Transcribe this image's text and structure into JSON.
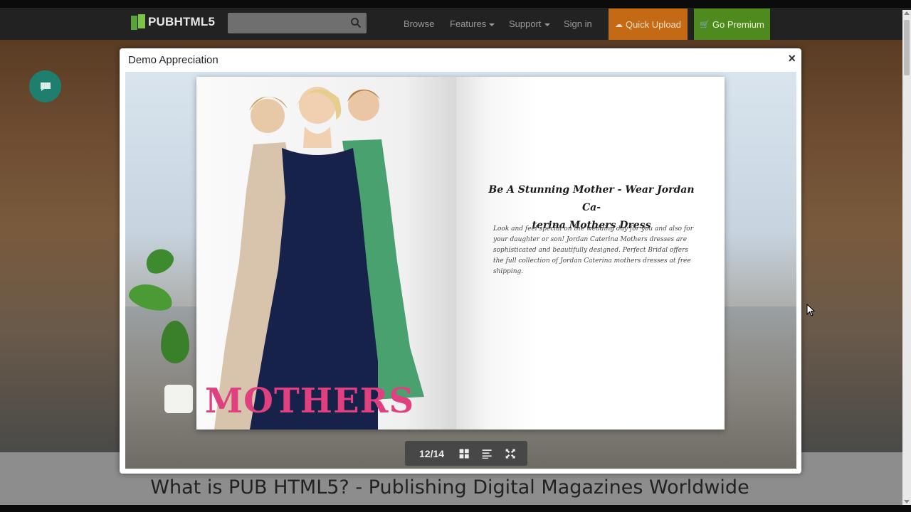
{
  "header": {
    "logo_text": "PUBHTML5",
    "search_placeholder": "",
    "nav": {
      "browse": "Browse",
      "features": "Features",
      "support": "Support",
      "signin": "Sign in"
    },
    "quick_upload": "Quick Upload",
    "go_premium": "Go Premium"
  },
  "modal": {
    "title": "Demo Appreciation",
    "close": "×",
    "left_page_word": "MOTHERS",
    "right_page_headline_1": "Be A Stunning Mother - Wear Jordan Ca-",
    "right_page_headline_2": "terina Mothers Dress",
    "right_page_body": "Look and feel special on the wedding day for you and also for your daughter or son! Jordan Caterina Mothers dresses are sophisticated and beautifully designed. Perfect Bridal offers the full collection of Jordan Caterina mothers dresses at free shipping.",
    "page_indicator": "12/14"
  },
  "page": {
    "bottom_title": "What is PUB HTML5? - Publishing Digital Magazines Worldwide"
  },
  "colors": {
    "upload_bg": "#c46a14",
    "premium_bg": "#4f8a1e",
    "chat_bg": "#1f7f6e",
    "mothers_pink": "#e0407f"
  },
  "icons": {
    "search": "search-icon",
    "chat": "chat-icon",
    "upload": "cloud-upload-icon",
    "cart": "cart-icon",
    "thumbnails": "grid-icon",
    "toc": "list-icon",
    "fullscreen": "fullscreen-icon"
  }
}
